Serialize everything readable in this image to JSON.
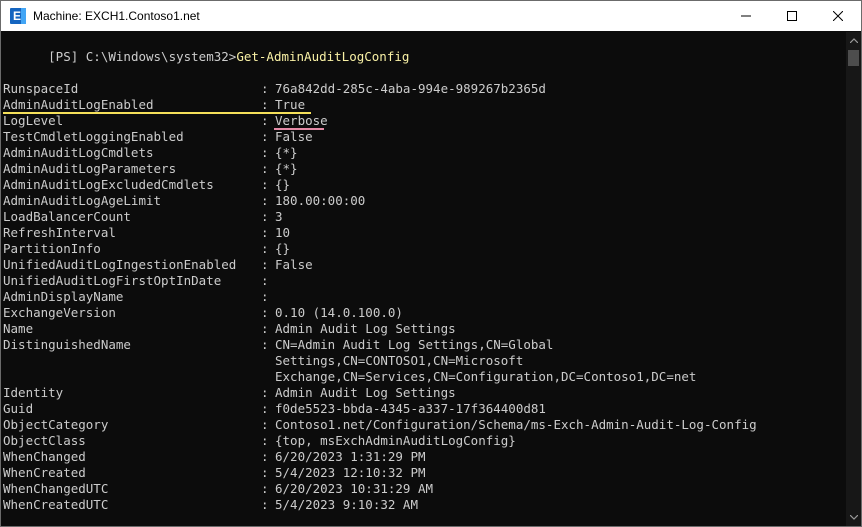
{
  "window": {
    "title": "Machine: EXCH1.Contoso1.net",
    "icon_letter": "E"
  },
  "console": {
    "prompt": "[PS] C:\\Windows\\system32>",
    "command": "Get-AdminAuditLogConfig",
    "separator": ": ",
    "rows": [
      {
        "key": "RunspaceId",
        "value": "76a842dd-285c-4aba-994e-989267b2365d"
      },
      {
        "key": "AdminAuditLogEnabled",
        "value": "True"
      },
      {
        "key": "LogLevel",
        "value": "Verbose"
      },
      {
        "key": "TestCmdletLoggingEnabled",
        "value": "False"
      },
      {
        "key": "AdminAuditLogCmdlets",
        "value": "{*}"
      },
      {
        "key": "AdminAuditLogParameters",
        "value": "{*}"
      },
      {
        "key": "AdminAuditLogExcludedCmdlets",
        "value": "{}"
      },
      {
        "key": "AdminAuditLogAgeLimit",
        "value": "180.00:00:00"
      },
      {
        "key": "LoadBalancerCount",
        "value": "3"
      },
      {
        "key": "RefreshInterval",
        "value": "10"
      },
      {
        "key": "PartitionInfo",
        "value": "{}"
      },
      {
        "key": "UnifiedAuditLogIngestionEnabled",
        "value": "False"
      },
      {
        "key": "UnifiedAuditLogFirstOptInDate",
        "value": ""
      },
      {
        "key": "AdminDisplayName",
        "value": ""
      },
      {
        "key": "ExchangeVersion",
        "value": "0.10 (14.0.100.0)"
      },
      {
        "key": "Name",
        "value": "Admin Audit Log Settings"
      },
      {
        "key": "DistinguishedName",
        "value": "CN=Admin Audit Log Settings,CN=Global"
      },
      {
        "key": "",
        "value": "Settings,CN=CONTOSO1,CN=Microsoft"
      },
      {
        "key": "",
        "value": "Exchange,CN=Services,CN=Configuration,DC=Contoso1,DC=net"
      },
      {
        "key": "Identity",
        "value": "Admin Audit Log Settings"
      },
      {
        "key": "Guid",
        "value": "f0de5523-bbda-4345-a337-17f364400d81"
      },
      {
        "key": "ObjectCategory",
        "value": "Contoso1.net/Configuration/Schema/ms-Exch-Admin-Audit-Log-Config"
      },
      {
        "key": "ObjectClass",
        "value": "{top, msExchAdminAuditLogConfig}"
      },
      {
        "key": "WhenChanged",
        "value": "6/20/2023 1:31:29 PM"
      },
      {
        "key": "WhenCreated",
        "value": "5/4/2023 12:10:32 PM"
      },
      {
        "key": "WhenChangedUTC",
        "value": "6/20/2023 10:31:29 AM"
      },
      {
        "key": "WhenCreatedUTC",
        "value": "5/4/2023 9:10:32 AM"
      }
    ]
  },
  "colors": {
    "highlight_yellow": "#f5e05a",
    "highlight_pink": "#e48aa6",
    "command": "#f9f1a5",
    "text": "#cccccc",
    "background": "#0c0c0c"
  }
}
